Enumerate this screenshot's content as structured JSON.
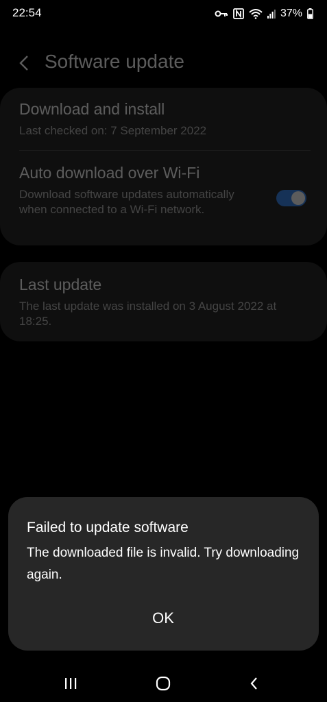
{
  "status_bar": {
    "time": "22:54",
    "battery": "37%",
    "icons": [
      "vpn-key-icon",
      "nfc-icon",
      "wifi-icon",
      "signal-icon",
      "battery-icon"
    ]
  },
  "header": {
    "title": "Software update",
    "back_icon": "chevron-left-icon"
  },
  "settings": {
    "download_install": {
      "title": "Download and install",
      "subtitle": "Last checked on: 7 September 2022"
    },
    "auto_download": {
      "title": "Auto download over Wi-Fi",
      "subtitle": "Download software updates automatically when connected to a Wi-Fi network.",
      "enabled": true
    },
    "last_update": {
      "title": "Last update",
      "subtitle": "The last update was installed on 3 August 2022 at 18:25."
    }
  },
  "dialog": {
    "title": "Failed to update software",
    "message": "The downloaded file is invalid. Try downloading again.",
    "ok_label": "OK"
  },
  "nav_bar": {
    "buttons": [
      "recent-apps-icon",
      "home-icon",
      "back-icon"
    ]
  },
  "colors": {
    "toggle_on": "#3e8cf2",
    "card_bg": "#2a2a2a",
    "dialog_bg": "#272727"
  }
}
